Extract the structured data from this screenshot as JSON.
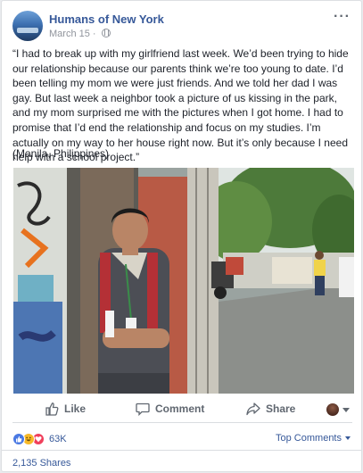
{
  "post": {
    "page_name": "Humans of New York",
    "date": "March 15",
    "more_glyph": "···",
    "text": "“I had to break up with my girlfriend last week. We’d been trying to hide our relationship because our parents think we’re too young to date. I’d been telling my mom we were just friends. And we told her dad I was gay. But last week a neighbor took a picture of us kissing in the park, and my mom surprised me with the pictures when I got home. I had to promise that I’d end the relationship and focus on my studies. I’m actually on my way to her house right now. But it’s only because I need help with a school project.”",
    "location": "(Manila, Philippines)",
    "audience_icon": "globe-icon"
  },
  "actions": {
    "like_label": "Like",
    "comment_label": "Comment",
    "share_label": "Share"
  },
  "stats": {
    "reaction_count": "63K",
    "reaction_types": [
      "like",
      "haha",
      "love"
    ],
    "sort_label": "Top Comments",
    "shares_label": "2,135 Shares"
  },
  "colors": {
    "brand_link": "#365899",
    "like_blue": "#4a79e3",
    "haha_yellow": "#f7b928",
    "love_red": "#f0405c"
  }
}
